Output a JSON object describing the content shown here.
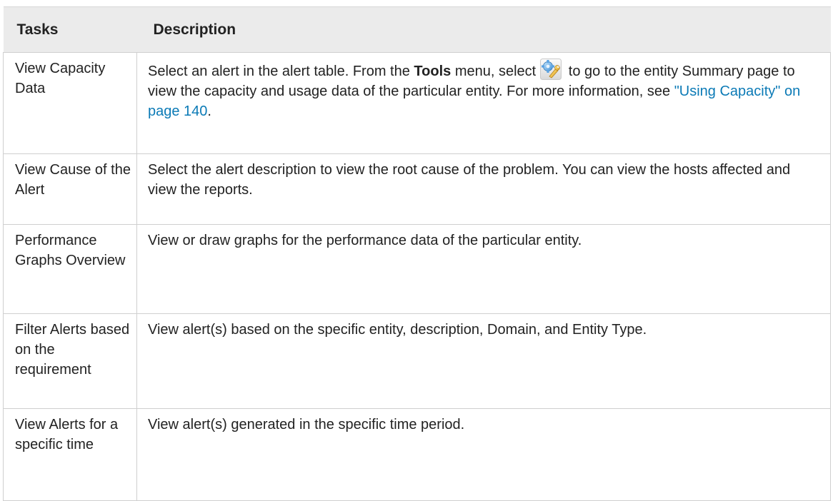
{
  "table": {
    "headers": {
      "tasks": "Tasks",
      "description": "Description"
    },
    "rows": [
      {
        "task": "View Capacity Data",
        "desc_part1": "Select an alert in the alert table. From the ",
        "desc_bold": "Tools",
        "desc_part2": " menu, select",
        "icon": "tools-icon",
        "desc_part3": " to go to the entity Summary page to view the capacity and usage data of the particular entity. For more information, see ",
        "link_text": "\"Using Capacity\" on page 140",
        "desc_end": "."
      },
      {
        "task": "View Cause of the Alert",
        "description": "Select the alert description to view the root cause of the problem. You can view the hosts affected and view the reports."
      },
      {
        "task": "Performance Graphs Overview",
        "description": "View or draw graphs for the performance data of the particular entity."
      },
      {
        "task": "Filter Alerts based on the requirement",
        "description": "View alert(s) based on the specific entity, description, Domain, and Entity Type."
      },
      {
        "task": "View Alerts for a specific time",
        "description": "View alert(s) generated in the specific time period."
      }
    ]
  },
  "colors": {
    "header_bg": "#ebebeb",
    "link": "#0b7ab6",
    "border": "#cfcfcf"
  }
}
